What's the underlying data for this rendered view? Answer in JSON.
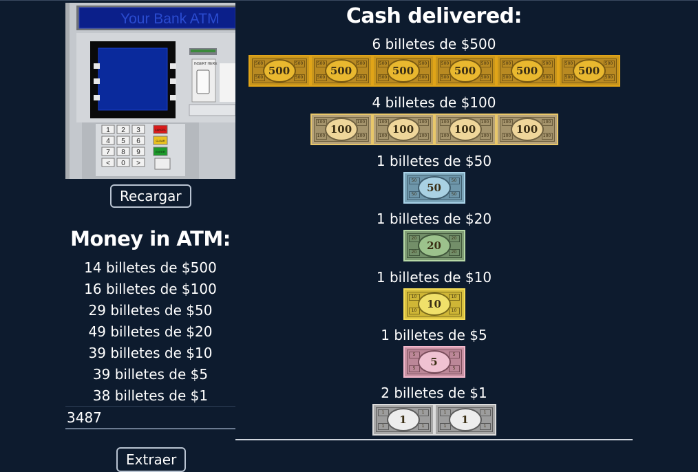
{
  "atm": {
    "screen_title": "Your Bank ATM",
    "insert_card_label": "INSERT HERE",
    "keypad": [
      "1",
      "2",
      "3",
      "4",
      "5",
      "6",
      "7",
      "8",
      "9",
      "<",
      "0",
      ">"
    ],
    "function_keys": [
      "CANCEL",
      "CLEAR",
      "ENTER"
    ],
    "colors": {
      "screen": "#0a2a9c",
      "body": "#bfc3c8",
      "cancel": "#d81b1b",
      "clear": "#e8c020",
      "enter": "#1c9a2a"
    }
  },
  "buttons": {
    "reload": "Recargar",
    "extract": "Extraer"
  },
  "money_in_atm": {
    "title": "Money in ATM:",
    "lines": [
      "14 billetes de $500",
      "16 billetes de $100",
      "29 billetes de $50",
      "49 billetes de $20",
      "39 billetes de $10",
      "39 billetes de $5",
      "38 billetes de $1"
    ]
  },
  "amount_input": {
    "value": "3487"
  },
  "cash_delivered": {
    "title": "Cash delivered:",
    "groups": [
      {
        "label": "6 billetes de $500",
        "denomination": "500",
        "count": 6,
        "style": "b500"
      },
      {
        "label": "4 billetes de $100",
        "denomination": "100",
        "count": 4,
        "style": "b100"
      },
      {
        "label": "1 billetes de $50",
        "denomination": "50",
        "count": 1,
        "style": "b50"
      },
      {
        "label": "1 billetes de $20",
        "denomination": "20",
        "count": 1,
        "style": "b20"
      },
      {
        "label": "1 billetes de $10",
        "denomination": "10",
        "count": 1,
        "style": "b10"
      },
      {
        "label": "1 billetes de $5",
        "denomination": "5",
        "count": 1,
        "style": "b5"
      },
      {
        "label": "2 billetes de $1",
        "denomination": "1",
        "count": 2,
        "style": "b1"
      }
    ]
  },
  "colors": {
    "background": "#0d1b2e",
    "text": "#ffffff",
    "button_border": "#b9c4d2"
  }
}
